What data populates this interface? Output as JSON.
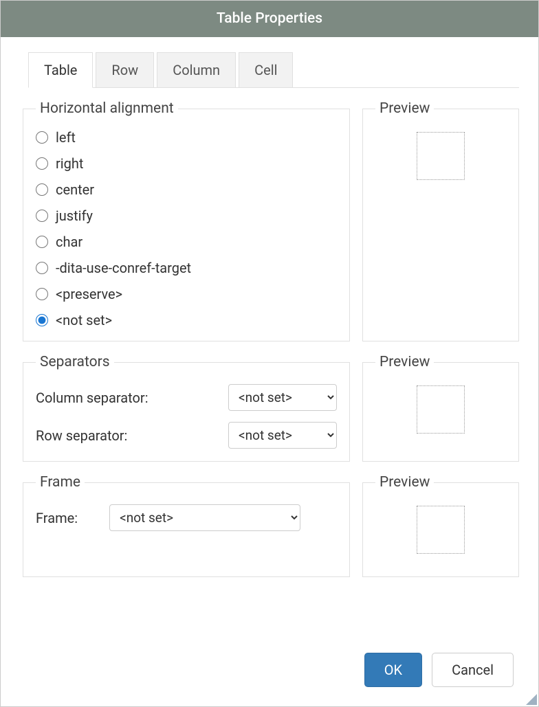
{
  "title": "Table Properties",
  "tabs": [
    {
      "label": "Table",
      "active": true
    },
    {
      "label": "Row",
      "active": false
    },
    {
      "label": "Column",
      "active": false
    },
    {
      "label": "Cell",
      "active": false
    }
  ],
  "halign": {
    "legend": "Horizontal alignment",
    "options": [
      {
        "label": "left",
        "checked": false
      },
      {
        "label": "right",
        "checked": false
      },
      {
        "label": "center",
        "checked": false
      },
      {
        "label": "justify",
        "checked": false
      },
      {
        "label": "char",
        "checked": false
      },
      {
        "label": "-dita-use-conref-target",
        "checked": false
      },
      {
        "label": "<preserve>",
        "checked": false
      },
      {
        "label": "<not set>",
        "checked": true
      }
    ]
  },
  "preview_label": "Preview",
  "separators": {
    "legend": "Separators",
    "col_label": "Column separator:",
    "col_value": "<not set>",
    "row_label": "Row separator:",
    "row_value": "<not set>"
  },
  "frame": {
    "legend": "Frame",
    "label": "Frame:",
    "value": "<not set>"
  },
  "buttons": {
    "ok": "OK",
    "cancel": "Cancel"
  }
}
